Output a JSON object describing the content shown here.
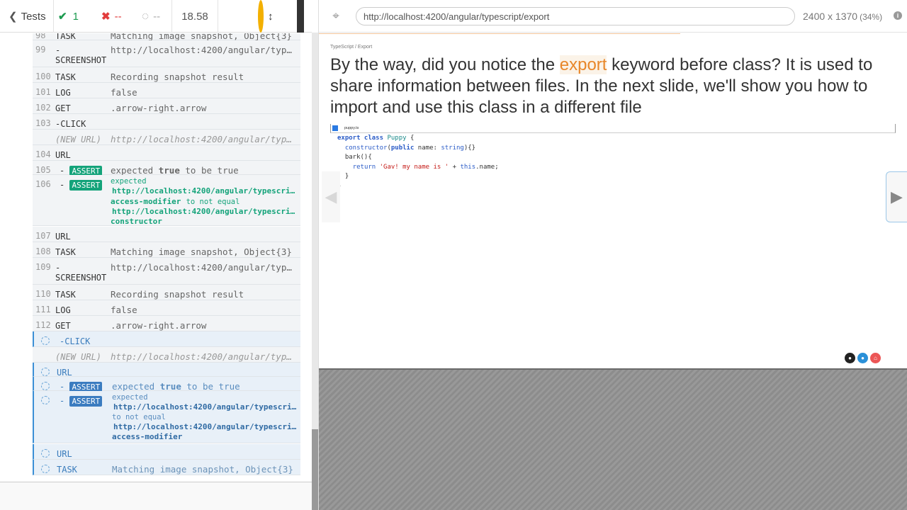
{
  "topbar": {
    "tests_label": "Tests",
    "passed_count": "1",
    "failed_count": "--",
    "pending_count": "--",
    "duration": "18.58"
  },
  "commands": [
    {
      "num": "98",
      "name": "TASK",
      "msg": "Matching image snapshot, Object{3}"
    },
    {
      "num": "99",
      "name": "-",
      "name2": "SCREENSHOT",
      "msg": "http://localhost:4200/angular/typescript/export"
    },
    {
      "num": "100",
      "name": "TASK",
      "msg": "Recording snapshot result"
    },
    {
      "num": "101",
      "name": "LOG",
      "msg": "false"
    },
    {
      "num": "102",
      "name": "GET",
      "msg": ".arrow-right.arrow"
    },
    {
      "num": "103",
      "name": "-CLICK",
      "msg": ""
    },
    {
      "num": "",
      "name": "(NEW URL)",
      "msg": "http://localhost:4200/angular/typescript/export"
    },
    {
      "num": "104",
      "name": "URL",
      "msg": ""
    },
    {
      "num": "105",
      "name": "- ASSERT",
      "msg_a": "expected",
      "msg_b": "true",
      "msg_c": "to be true"
    },
    {
      "num": "106",
      "name": "- ASSERT",
      "msg_a": "expected",
      "url1": "http://localhost:4200/angular/typescript/",
      "word1": "access-modifier",
      "mid": "to not equal",
      "url2": "http://localhost:4200/angular/typescript/",
      "word2": "constructor"
    },
    {
      "num": "107",
      "name": "URL",
      "msg": ""
    },
    {
      "num": "108",
      "name": "TASK",
      "msg": "Matching image snapshot, Object{3}"
    },
    {
      "num": "109",
      "name": "-",
      "name2": "SCREENSHOT",
      "msg": "http://localhost:4200/angular/typescript/export"
    },
    {
      "num": "110",
      "name": "TASK",
      "msg": "Recording snapshot result"
    },
    {
      "num": "111",
      "name": "LOG",
      "msg": "false"
    },
    {
      "num": "112",
      "name": "GET",
      "msg": ".arrow-right.arrow"
    }
  ],
  "pending_commands": [
    {
      "name": "-CLICK",
      "msg": ""
    },
    {
      "name": "(NEW URL)",
      "msg": "http://localhost:4200/angular/typescript/export"
    },
    {
      "name": "URL",
      "msg": ""
    },
    {
      "name": "- ASSERT",
      "msg_a": "expected",
      "msg_b": "true",
      "msg_c": "to be true"
    },
    {
      "name": "- ASSERT",
      "msg_a": "expected",
      "url1": "http://localhost:4200/angular/typescript/",
      "mid": "to not equal",
      "url2": "http://localhost:4200/angular/typescript/",
      "word2": "access-modifier"
    },
    {
      "name": "URL",
      "msg": ""
    },
    {
      "name": "TASK",
      "msg": "Matching image snapshot, Object{3}"
    }
  ],
  "aut": {
    "url": "http://localhost:4200/angular/typescript/export",
    "viewport": "2400 x 1370",
    "scale": "(34%)",
    "breadcrumb": "TypeScript / Export",
    "headline_pre": "By the way, did you notice the ",
    "headline_kw": "export",
    "headline_post": " keyword before class? It is used to share information between files. In the next slide, we'll show you how to import and use this class in a different file",
    "file_tab": "puppy.ts"
  },
  "colors": {
    "pass": "#1d9b50",
    "fail": "#e23c3c",
    "accent": "#3b8fd6",
    "assert_badge": "#14a37a",
    "keyword_highlight": "#e8872a"
  }
}
